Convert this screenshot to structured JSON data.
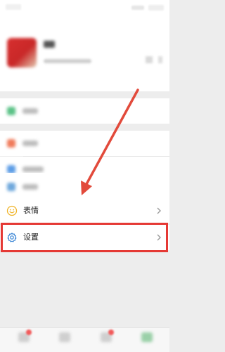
{
  "menu": {
    "emoji_label": "表情",
    "settings_label": "设置"
  },
  "icons": {
    "emoji": "smile-icon",
    "settings": "gear-icon",
    "chevron": "chevron-right-icon"
  },
  "colors": {
    "highlight": "#e53935",
    "icon_emoji": "#f0b429",
    "icon_settings": "#2d7dd2"
  }
}
